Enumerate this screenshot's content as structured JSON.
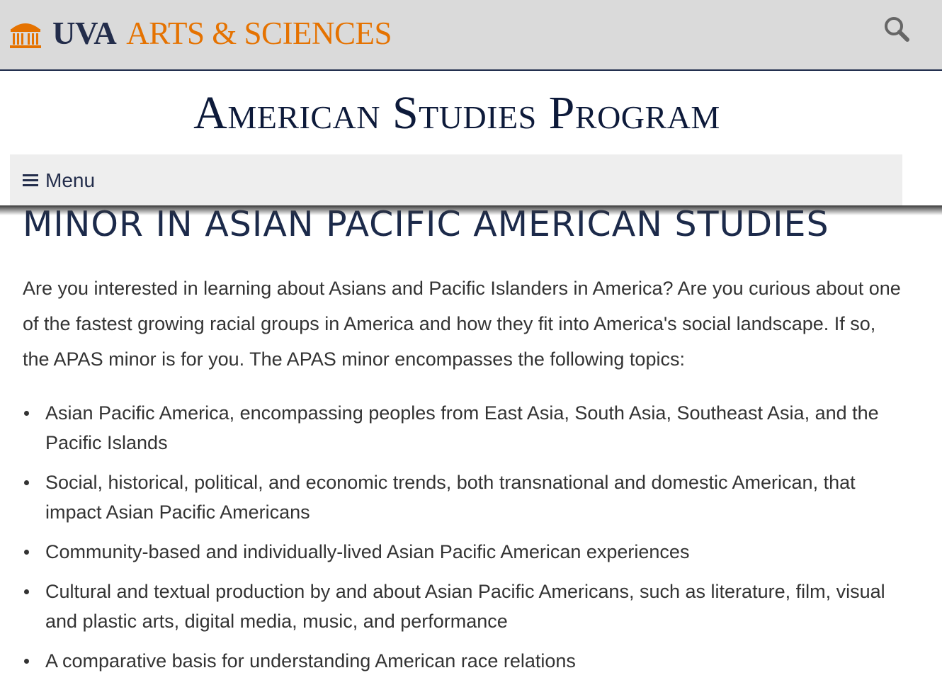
{
  "header": {
    "logo_uva": "UVA",
    "logo_arts": "ARTS & SCIENCES",
    "brand_colors": {
      "navy": "#232d4b",
      "orange": "#e57200"
    },
    "search_icon": "search-icon"
  },
  "program_title": "American Studies Program",
  "menu": {
    "label": "Menu",
    "icon": "hamburger-icon"
  },
  "main": {
    "heading": "MINOR IN ASIAN PACIFIC AMERICAN STUDIES",
    "intro": "Are you interested in learning about Asians and Pacific Islanders in America? Are you curious about one of the fastest growing racial groups in America and how they fit into America's social landscape. If so, the APAS minor is for you. The APAS minor encompasses the following topics:",
    "topics": [
      "Asian Pacific America, encompassing peoples from East Asia, South Asia, Southeast Asia, and the Pacific Islands",
      "Social, historical, political, and economic trends, both transnational and domestic American, that impact Asian Pacific Americans",
      "Community-based and individually-lived Asian Pacific American experiences",
      "Cultural and textual production by and about Asian Pacific Americans, such as literature, film, visual and plastic arts, digital media, music, and performance",
      "A comparative basis for understanding American race relations"
    ]
  }
}
